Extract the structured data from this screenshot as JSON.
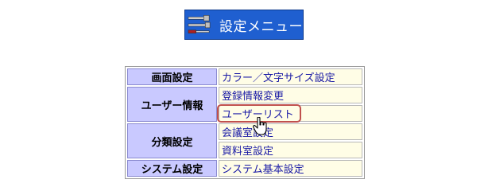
{
  "banner": {
    "title": "設定メニュー",
    "icon": "tools-icon",
    "color": "#1f5fd0"
  },
  "menu": {
    "rows": [
      {
        "category": "画面設定",
        "items": [
          "カラー／文字サイズ設定"
        ]
      },
      {
        "category": "ユーザー情報",
        "items": [
          "登録情報変更",
          "ユーザーリスト"
        ]
      },
      {
        "category": "分類設定",
        "items": [
          "会議室設定",
          "資料室設定"
        ]
      },
      {
        "category": "システム設定",
        "items": [
          "システム基本設定"
        ]
      }
    ]
  },
  "highlight_color": "#c0504d",
  "cursor_icon": "hand-pointer-icon"
}
